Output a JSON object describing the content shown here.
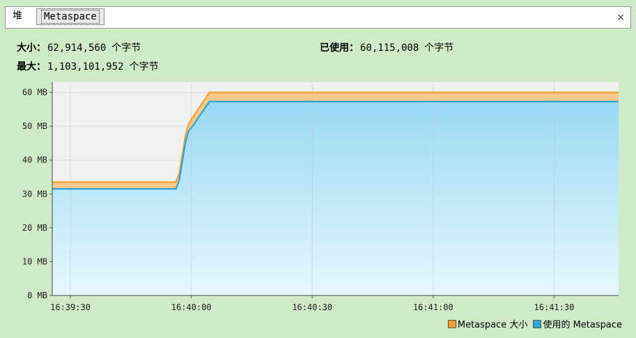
{
  "tabs": [
    {
      "label": "堆",
      "active": false
    },
    {
      "label": "Metaspace",
      "active": true
    }
  ],
  "close_label": "×",
  "stats": {
    "size": {
      "label": "大小：",
      "value": "62,914,560",
      "unit": "个字节"
    },
    "max": {
      "label": "最大：",
      "value": "1,103,101,952",
      "unit": "个字节"
    },
    "used": {
      "label": "已使用：",
      "value": "60,115,008",
      "unit": "个字节"
    }
  },
  "legend": [
    {
      "label": "Metaspace 大小",
      "color": "#f0a030"
    },
    {
      "label": "使用的 Metaspace",
      "color": "#30a8d8"
    }
  ],
  "colors": {
    "size_line": "#f0a030",
    "size_fill": "#f6c98a",
    "used_line": "#2ea3d6",
    "used_fill_top": "#9ad9f3",
    "used_fill_bottom": "#e6f7fd",
    "plot_bg": "#f0f0f0"
  },
  "chart_data": {
    "type": "area",
    "x_ticks": [
      "16:39:30",
      "16:40:00",
      "16:40:30",
      "16:41:00",
      "16:41:30"
    ],
    "x_tick_seconds": [
      30,
      60,
      90,
      120,
      150
    ],
    "xlim_seconds": [
      25.5,
      166
    ],
    "y_ticks": [
      "0 MB",
      "10 MB",
      "20 MB",
      "30 MB",
      "40 MB",
      "50 MB",
      "60 MB"
    ],
    "ylim": [
      0,
      63
    ],
    "y_unit": "MB",
    "grid": true,
    "legend_position": "bottom-right",
    "series": [
      {
        "name": "Metaspace 大小",
        "x_seconds": [
          25.5,
          56.2,
          57.0,
          58.5,
          59.3,
          60.0,
          64.5,
          166
        ],
        "values": [
          33.5,
          33.5,
          36.0,
          47.0,
          50.5,
          52.0,
          60.0,
          60.0
        ]
      },
      {
        "name": "使用的 Metaspace",
        "x_seconds": [
          25.5,
          56.2,
          57.0,
          58.5,
          59.3,
          60.0,
          64.5,
          166
        ],
        "values": [
          31.5,
          31.5,
          34.0,
          45.0,
          48.5,
          49.5,
          57.3,
          57.3
        ]
      }
    ]
  }
}
